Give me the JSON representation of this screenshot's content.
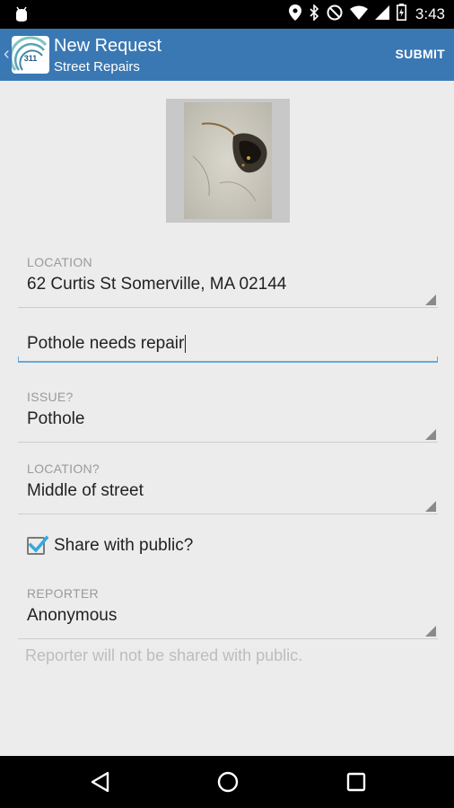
{
  "status_bar": {
    "time": "3:43",
    "icons": [
      "android-debug-icon",
      "location-pin-icon",
      "bluetooth-icon",
      "do-not-disturb-icon",
      "wifi-icon",
      "cell-signal-icon",
      "battery-icon"
    ]
  },
  "action_bar": {
    "logo_text": "311",
    "title": "New Request",
    "subtitle": "Street Repairs",
    "submit_label": "SUBMIT",
    "color": "#3a78b4"
  },
  "form": {
    "location": {
      "label": "LOCATION",
      "value": "62 Curtis St Somerville, MA 02144"
    },
    "description": {
      "value": "Pothole needs repair"
    },
    "issue": {
      "label": "ISSUE?",
      "value": "Pothole"
    },
    "issue_location": {
      "label": "LOCATION?",
      "value": "Middle of street"
    },
    "share": {
      "label": "Share with public?",
      "checked": true,
      "accent": "#33a9dd"
    },
    "reporter": {
      "label": "REPORTER",
      "value": "Anonymous"
    },
    "reporter_hint": "Reporter will not be shared with public."
  },
  "nav_bar": {
    "buttons": [
      "back-icon",
      "home-icon",
      "recents-icon"
    ]
  }
}
